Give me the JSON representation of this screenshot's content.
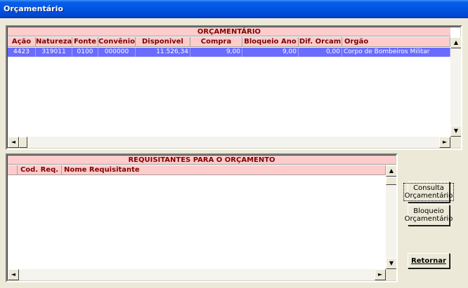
{
  "window": {
    "title": "Orçamentário"
  },
  "orcamentario": {
    "title": "ORÇAMENTÁRIO",
    "columns": [
      "Ação",
      "Natureza",
      "Fonte",
      "Convênio",
      "Disponivel",
      "Compra",
      "Bloqueio Ano",
      "Dif. Orcam",
      "Orgão"
    ],
    "rows": [
      [
        "4423",
        "319011",
        "0100",
        "000000",
        "11.526,34",
        "9,00",
        "9,00",
        "0,00",
        "Corpo de Bombeiros Militar"
      ]
    ]
  },
  "requisitantes": {
    "title": "REQUISITANTES PARA O ORÇAMENTO",
    "columns": [
      "",
      "Cod. Req.",
      "Nome Requisitante"
    ],
    "rows": []
  },
  "buttons": {
    "consulta_line1": "Consulta",
    "consulta_line2": "Orçamentário",
    "bloqueio_line1": "Bloqueio",
    "bloqueio_line2": "Orçamentário",
    "retornar": "Retornar"
  },
  "icons": {
    "arrow_up": "▲",
    "arrow_down": "▼",
    "arrow_left": "◄",
    "arrow_right": "►"
  },
  "colors": {
    "header_bg": "#ffcccc",
    "header_text": "#800000",
    "selected_row": "#6a6cff",
    "titlebar": "#0054e3"
  }
}
